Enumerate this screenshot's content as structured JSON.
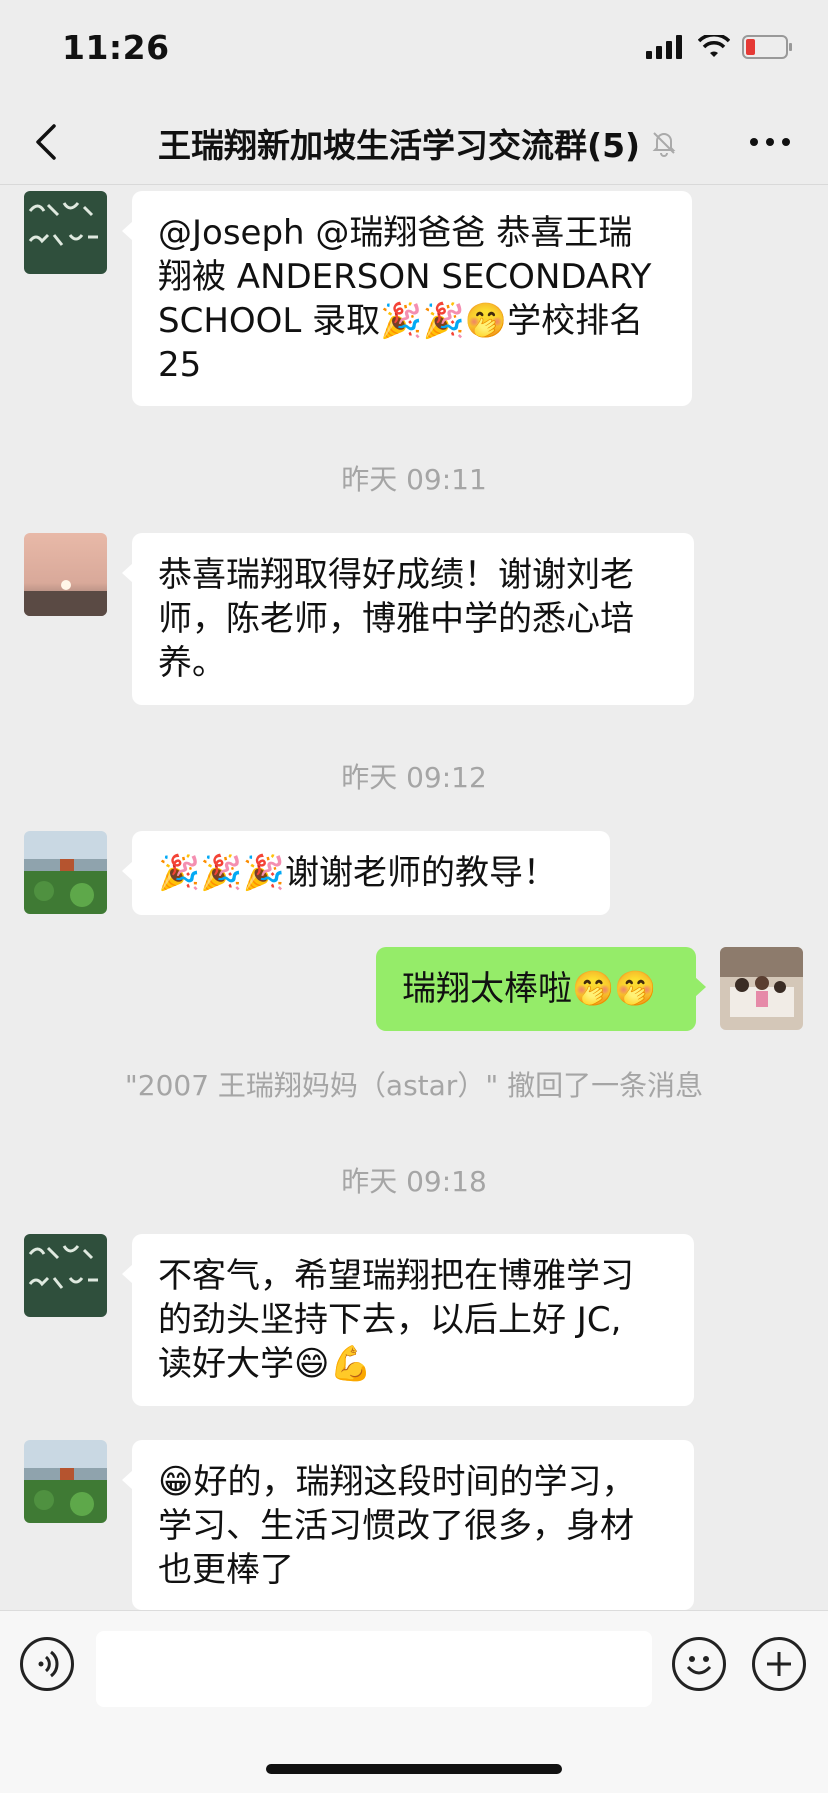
{
  "status": {
    "time": "11:26"
  },
  "header": {
    "title": "王瑞翔新加坡生活学习交流群(5)"
  },
  "messages": [
    {
      "text_lines": [
        "@Joseph @瑞翔爸爸 恭喜王瑞",
        "翔被 ANDERSON SECONDARY",
        "SCHOOL 录取🎉🎉🤭学校排名",
        "25"
      ]
    },
    {
      "timestamp": "昨天 09:11"
    },
    {
      "text_lines": [
        "恭喜瑞翔取得好成绩！谢谢刘老",
        "师，陈老师，博雅中学的悉心培",
        "养。"
      ]
    },
    {
      "timestamp": "昨天 09:12"
    },
    {
      "text": "🎉🎉🎉谢谢老师的教导！"
    },
    {
      "text": "瑞翔太棒啦🤭🤭"
    },
    {
      "system": "\"2007 王瑞翔妈妈（astar）\" 撤回了一条消息"
    },
    {
      "timestamp": "昨天 09:18"
    },
    {
      "text_lines": [
        "不客气，希望瑞翔把在博雅学习",
        "的劲头坚持下去，以后上好 JC,",
        "读好大学😄💪"
      ]
    },
    {
      "text_lines": [
        "😁好的，瑞翔这段时间的学习，",
        "学习、生活习惯改了很多，身材",
        "也更棒了"
      ]
    }
  ],
  "icons": {
    "back": "chevron-left-icon",
    "mute": "bell-off-icon",
    "more": "more-dots-icon",
    "voice": "voice-icon",
    "emoji": "emoji-icon",
    "plus": "plus-icon"
  },
  "colors": {
    "accent_bubble": "#95ec69",
    "background": "#ededed"
  }
}
